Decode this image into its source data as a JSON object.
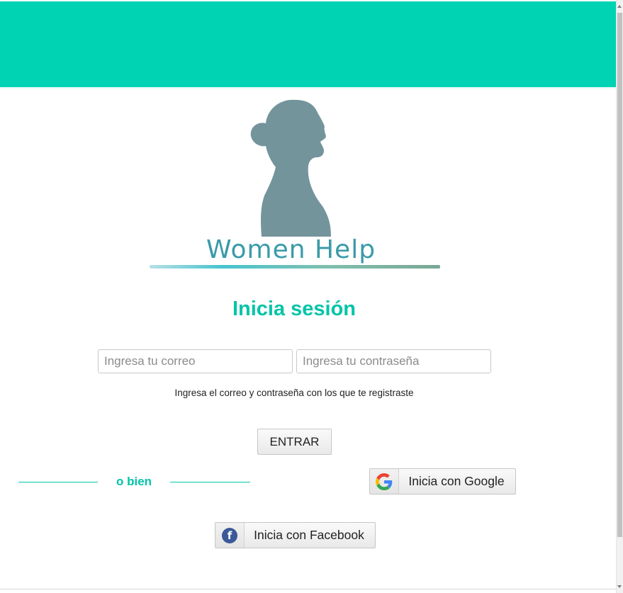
{
  "brand": {
    "name": "Women Help",
    "primary_color": "#00d3b4",
    "text_accent": "#00c4a8",
    "logo_color": "#3a9aa8",
    "silhouette_color": "#74949c"
  },
  "login": {
    "title": "Inicia sesión",
    "email_placeholder": "Ingresa tu correo",
    "password_placeholder": "Ingresa tu contraseña",
    "hint": "Ingresa el correo y contraseña con los que te registraste",
    "submit_label": "ENTRAR"
  },
  "separator": {
    "text": "o bien"
  },
  "social": {
    "google": {
      "label": "Inicia con Google",
      "icon": "google-g-icon"
    },
    "facebook": {
      "label": "Inicia con Facebook",
      "icon": "facebook-f-icon",
      "color": "#3b5998"
    }
  }
}
